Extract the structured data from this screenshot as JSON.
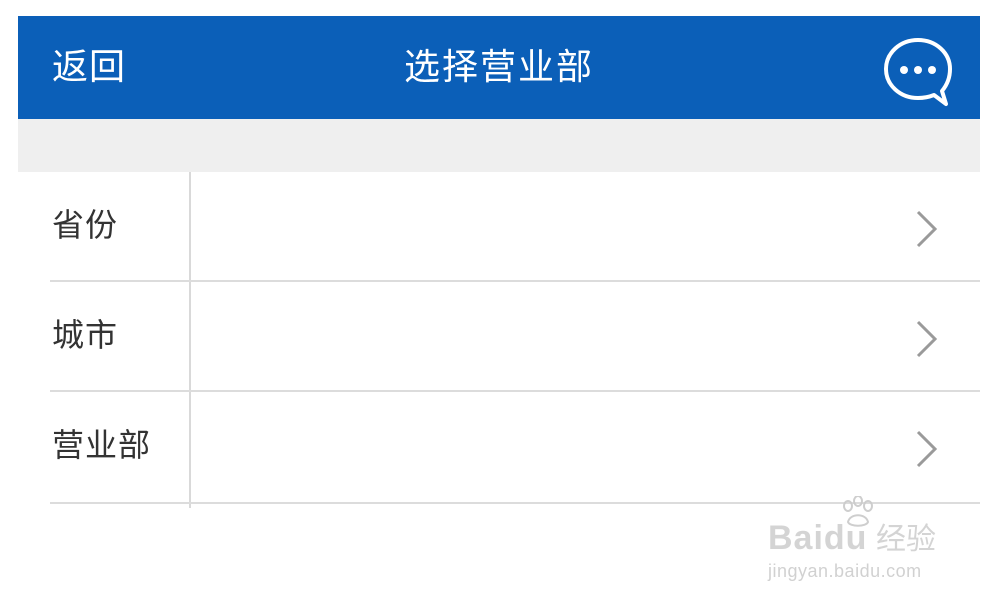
{
  "header": {
    "back_label": "返回",
    "title": "选择营业部",
    "chat_icon": "chat-bubble-ellipsis-icon"
  },
  "rows": [
    {
      "label": "省份",
      "chevron_icon": "chevron-right-icon"
    },
    {
      "label": "城市",
      "chevron_icon": "chevron-right-icon"
    },
    {
      "label": "营业部",
      "chevron_icon": "chevron-right-icon"
    }
  ],
  "watermark": {
    "brand": "Baidu",
    "brand_cn": "经验",
    "url": "jingyan.baidu.com"
  },
  "colors": {
    "header_bg": "#0b5fb8",
    "header_text": "#ffffff",
    "band_bg": "#efefef",
    "divider": "#dcdcdc",
    "label_text": "#333333",
    "chevron": "#9a9a9a"
  }
}
